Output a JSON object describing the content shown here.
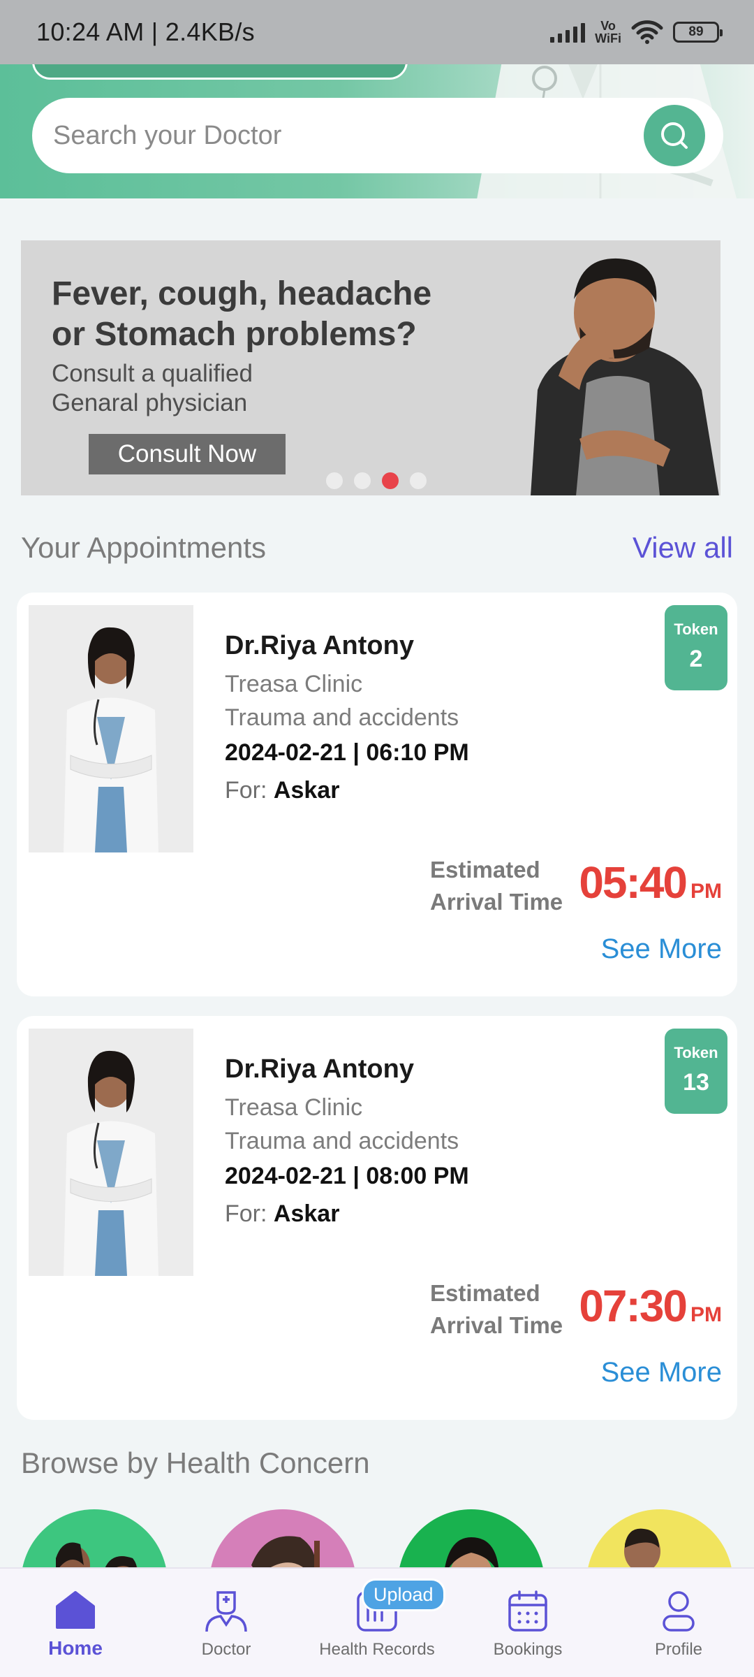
{
  "status_bar": {
    "time": "10:24 AM | 2.4KB/s",
    "vowifi_top": "Vo",
    "vowifi_bottom": "WiFi",
    "battery": "89"
  },
  "search": {
    "placeholder": "Search your Doctor",
    "icon": "search-icon"
  },
  "banner": {
    "title_line1": "Fever, cough, headache",
    "title_line2": "or Stomach problems?",
    "sub_line1": "Consult a qualified",
    "sub_line2": "Genaral physician",
    "button_label": "Consult Now",
    "dots_total": 4,
    "active_dot_index": 2
  },
  "appointments": {
    "title": "Your Appointments",
    "view_all": "View all",
    "items": [
      {
        "doctor": "Dr.Riya Antony",
        "clinic": "Treasa Clinic",
        "specialty": "Trauma and accidents",
        "datetime": "2024-02-21 | 06:10 PM",
        "for_label": "For:",
        "for_name": "Askar",
        "token_label": "Token",
        "token_number": "2",
        "eta_line1": "Estimated",
        "eta_line2": "Arrival Time",
        "eta_time": "05:40",
        "eta_ampm": "PM",
        "see_more": "See More"
      },
      {
        "doctor": "Dr.Riya Antony",
        "clinic": "Treasa Clinic",
        "specialty": "Trauma and accidents",
        "datetime": "2024-02-21 | 08:00 PM",
        "for_label": "For:",
        "for_name": "Askar",
        "token_label": "Token",
        "token_number": "13",
        "eta_line1": "Estimated",
        "eta_line2": "Arrival Time",
        "eta_time": "07:30",
        "eta_ampm": "PM",
        "see_more": "See More"
      }
    ]
  },
  "health_concern": {
    "title": "Browse by Health Concern",
    "circle_colors": [
      "#3dc67f",
      "#d57fb9",
      "#19b24f",
      "#f1e45e"
    ]
  },
  "bottom_nav": {
    "items": [
      {
        "label": "Home",
        "icon": "home-icon",
        "active": true
      },
      {
        "label": "Doctor",
        "icon": "doctor-icon",
        "active": false
      },
      {
        "label": "Health Records",
        "icon": "health-records-icon",
        "active": false,
        "badge": "Upload"
      },
      {
        "label": "Bookings",
        "icon": "calendar-icon",
        "active": false
      },
      {
        "label": "Profile",
        "icon": "profile-icon",
        "active": false
      }
    ]
  },
  "colors": {
    "accent_green": "#52b592",
    "accent_purple": "#5b52d6",
    "eta_red": "#e5413a",
    "link_blue": "#2a8ed6"
  }
}
